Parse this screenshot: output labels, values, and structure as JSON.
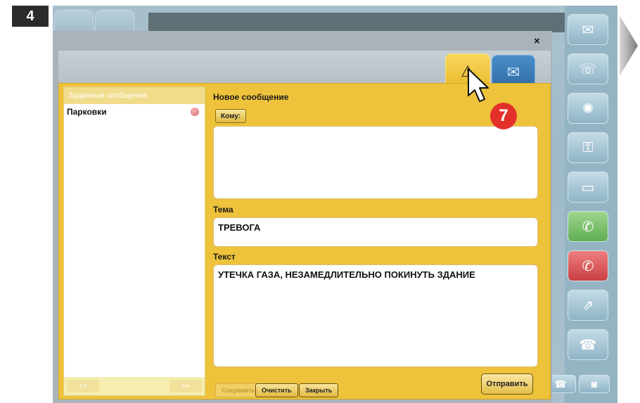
{
  "step": "4",
  "callout": "7",
  "dialog": {
    "close": "×",
    "tabs": {
      "warning_icon": "warning-icon",
      "mail_icon": "mail-icon"
    },
    "preset_header": "Заданные сообщения",
    "presets": [
      {
        "label": "Парковки"
      }
    ],
    "pager": {
      "prev": "<<",
      "next": ">>"
    },
    "new_message": "Новое сообщение",
    "to_button": "Кому:",
    "recipients": "",
    "subject_label": "Тема",
    "subject": "ТРЕВОГА",
    "text_label": "Текст",
    "text": "УТЕЧКА ГАЗА, НЕЗАМЕДЛИТЕЛЬНО ПОКИНУТЬ ЗДАНИЕ",
    "buttons": {
      "save": "Сохранить",
      "clear": "Очистить",
      "close": "Закрыть",
      "send": "Отправить"
    }
  },
  "colors": {
    "accent": "#eec23a",
    "callout": "#e4302b",
    "mail_tab": "#2e6aa5"
  },
  "side_icons": [
    "mail-icon",
    "contacts-icon",
    "broadcast-icon",
    "key-icon",
    "camera-icon",
    "call-accept-icon",
    "call-reject-icon",
    "transfer-icon",
    "handset-icon"
  ]
}
